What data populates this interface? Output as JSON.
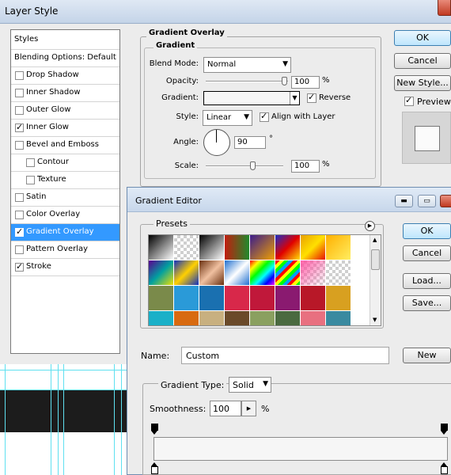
{
  "layer_style": {
    "title": "Layer Style",
    "styles_header": "Styles",
    "list": [
      {
        "label": "Blending Options: Default",
        "checkbox": false,
        "checked": false,
        "indent": 0,
        "selected": false
      },
      {
        "label": "Drop Shadow",
        "checkbox": true,
        "checked": false,
        "indent": 0,
        "selected": false
      },
      {
        "label": "Inner Shadow",
        "checkbox": true,
        "checked": false,
        "indent": 0,
        "selected": false
      },
      {
        "label": "Outer Glow",
        "checkbox": true,
        "checked": false,
        "indent": 0,
        "selected": false
      },
      {
        "label": "Inner Glow",
        "checkbox": true,
        "checked": true,
        "indent": 0,
        "selected": false
      },
      {
        "label": "Bevel and Emboss",
        "checkbox": true,
        "checked": false,
        "indent": 0,
        "selected": false
      },
      {
        "label": "Contour",
        "checkbox": true,
        "checked": false,
        "indent": 1,
        "selected": false
      },
      {
        "label": "Texture",
        "checkbox": true,
        "checked": false,
        "indent": 1,
        "selected": false
      },
      {
        "label": "Satin",
        "checkbox": true,
        "checked": false,
        "indent": 0,
        "selected": false
      },
      {
        "label": "Color Overlay",
        "checkbox": true,
        "checked": false,
        "indent": 0,
        "selected": false
      },
      {
        "label": "Gradient Overlay",
        "checkbox": true,
        "checked": true,
        "indent": 0,
        "selected": true
      },
      {
        "label": "Pattern Overlay",
        "checkbox": true,
        "checked": false,
        "indent": 0,
        "selected": false
      },
      {
        "label": "Stroke",
        "checkbox": true,
        "checked": true,
        "indent": 0,
        "selected": false
      }
    ],
    "panel": {
      "section_title": "Gradient Overlay",
      "group_title": "Gradient",
      "blend_mode_label": "Blend Mode:",
      "blend_mode_value": "Normal",
      "opacity_label": "Opacity:",
      "opacity_value": "100",
      "opacity_fraction": 1.0,
      "percent": "%",
      "gradient_label": "Gradient:",
      "reverse_label": "Reverse",
      "reverse_checked": true,
      "style_label": "Style:",
      "style_value": "Linear",
      "align_label": "Align with Layer",
      "align_checked": true,
      "angle_label": "Angle:",
      "angle_value": "90",
      "degree": "°",
      "scale_label": "Scale:",
      "scale_value": "100",
      "scale_fraction": 0.6
    },
    "buttons": {
      "ok": "OK",
      "cancel": "Cancel",
      "new_style": "New Style...",
      "preview": "Preview",
      "preview_checked": true
    }
  },
  "gradient_editor": {
    "title": "Gradient Editor",
    "presets_label": "Presets",
    "buttons": {
      "ok": "OK",
      "cancel": "Cancel",
      "load": "Load...",
      "save": "Save...",
      "new": "New"
    },
    "name_label": "Name:",
    "name_value": "Custom",
    "gradient_type_label": "Gradient Type:",
    "gradient_type_value": "Solid",
    "smoothness_label": "Smoothness:",
    "smoothness_value": "100",
    "percent": "%",
    "presets": [
      [
        "linear-gradient(135deg,#000,#fff)",
        "checker-white",
        "linear-gradient(135deg,#000,#fff)",
        "linear-gradient(90deg,#c21e0e,#1f8a2c)",
        "linear-gradient(135deg,#3a1c8c,#f0a000)",
        "linear-gradient(135deg,#1b2ec6,#e00000,#ffe000)",
        "linear-gradient(135deg,#e8a000,#ffe000,#e81000)",
        "linear-gradient(135deg,#ffb000,#ffee60)"
      ],
      [
        "linear-gradient(135deg,#5a0090,#00a0a0,#f0e000)",
        "linear-gradient(135deg,#1030c0,#ffd000,#1030c0)",
        "linear-gradient(135deg,#6a3010,#f0c0a0,#6a3010)",
        "linear-gradient(135deg,#2070d0,#ffffff,#2070d0)",
        "linear-gradient(135deg,#ff0000,#ffff00,#00ff00,#00ffff,#0000ff,#ff00ff)",
        "repeating-linear-gradient(135deg,#ff0000 0 4px,#ffff00 4px 8px,#00ff00 8px 12px,#00a0ff 12px 16px)",
        "checker-pink",
        "checker-white"
      ],
      [
        "#7a8a4a",
        "#2a9ad8",
        "#1a70b0",
        "#d8284a",
        "#c0183a",
        "#8a1a70",
        "#b81828",
        "#d8a020"
      ],
      [
        "#1ab0c8",
        "#d86a10",
        "#c8b080",
        "#6a4a2a",
        "#8aa060",
        "#4a6a40",
        "#e87080",
        "#3a8aa0"
      ]
    ],
    "colors": {
      "accent": "#3399ff"
    }
  }
}
